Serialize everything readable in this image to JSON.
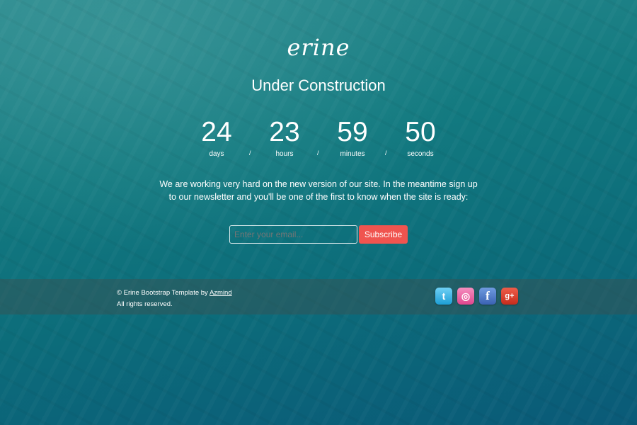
{
  "logo": "erine",
  "title": "Under Construction",
  "countdown": [
    {
      "value": "24",
      "label": "days"
    },
    {
      "value": "23",
      "label": "hours"
    },
    {
      "value": "59",
      "label": "minutes"
    },
    {
      "value": "50",
      "label": "seconds"
    }
  ],
  "separator": "/",
  "message": "We are working very hard on the new version of our site. In the meantime sign up to our newsletter and you'll be one of the first to know when the site is ready:",
  "form": {
    "email_placeholder": "Enter your email...",
    "subscribe_label": "Subscribe"
  },
  "footer": {
    "copyright_prefix": "© Erine Bootstrap Template by",
    "author_link": "Azmind",
    "rights": "All rights reserved."
  },
  "social": [
    {
      "icon": "twitter-icon",
      "glyph": "t"
    },
    {
      "icon": "dribbble-icon",
      "glyph": "◎"
    },
    {
      "icon": "facebook-icon",
      "glyph": "f"
    },
    {
      "icon": "google-plus-icon",
      "glyph": "g+"
    }
  ],
  "colors": {
    "accent": "#f0544f",
    "background": "#137a80"
  }
}
